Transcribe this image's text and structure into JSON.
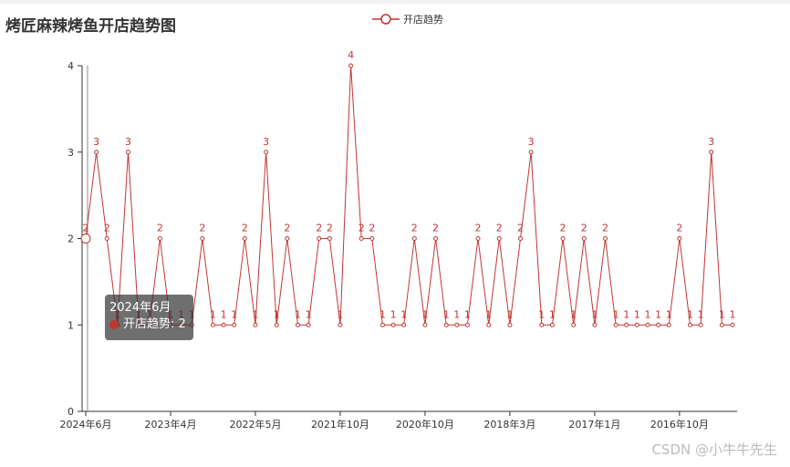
{
  "page_title": "烤匠麻辣烤鱼开店趋势图",
  "colors": {
    "series": "#c23531",
    "axis": "#333333",
    "tooltip_bg": "#323232"
  },
  "legend": {
    "label": "开店趋势",
    "icon": "circle-line-icon"
  },
  "tooltip": {
    "title": "2024年6月",
    "series_name": "开店趋势",
    "value": "2",
    "text": "开店趋势: 2"
  },
  "watermark": "CSDN @小牛牛先生",
  "chart_data": {
    "type": "line",
    "title": "烤匠麻辣烤鱼开店趋势图",
    "xlabel": "",
    "ylabel": "",
    "ylim": [
      0,
      4
    ],
    "yticks": [
      0,
      1,
      2,
      3,
      4
    ],
    "grid": false,
    "legend_position": "top",
    "xtick_labels": [
      "2024年6月",
      "2023年4月",
      "2022年5月",
      "2021年10月",
      "2020年10月",
      "2018年3月",
      "2017年1月",
      "2016年10月"
    ],
    "series": [
      {
        "name": "开店趋势",
        "values": [
          2,
          3,
          2,
          1,
          3,
          1,
          1,
          2,
          1,
          1,
          1,
          2,
          1,
          1,
          1,
          2,
          1,
          3,
          1,
          2,
          1,
          1,
          2,
          2,
          1,
          4,
          2,
          2,
          1,
          1,
          1,
          2,
          1,
          2,
          1,
          1,
          1,
          2,
          1,
          2,
          1,
          2,
          3,
          1,
          1,
          2,
          1,
          2,
          1,
          2,
          1,
          1,
          1,
          1,
          1,
          1,
          2,
          1,
          1,
          3,
          1,
          1
        ]
      }
    ]
  }
}
